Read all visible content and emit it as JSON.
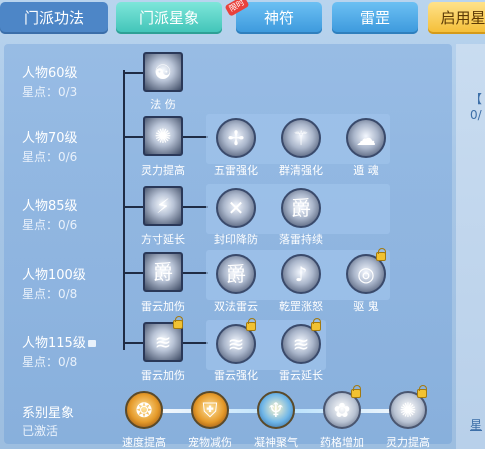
{
  "tabs": [
    {
      "label": "门派功法"
    },
    {
      "label": "门派星象"
    },
    {
      "label": "神符",
      "badge": "限时"
    },
    {
      "label": "雷罡"
    },
    {
      "label": "启用星"
    }
  ],
  "right_strip": {
    "bracket": "【",
    "value": "0/",
    "link": "星"
  },
  "tiers": [
    {
      "name": "人物60级",
      "stars": "星点：0/3"
    },
    {
      "name": "人物70级",
      "stars": "星点：0/6"
    },
    {
      "name": "人物85级",
      "stars": "星点：0/6"
    },
    {
      "name": "人物100级",
      "stars": "星点：0/8"
    },
    {
      "name": "人物115级",
      "stars": "星点：0/8"
    }
  ],
  "skills": {
    "main": [
      "法 伤",
      "灵力提高",
      "方寸延长",
      "雷云加伤",
      "雷云加伤"
    ],
    "row70": [
      "五雷强化",
      "群清强化",
      "遁 魂"
    ],
    "row85": [
      "封印降防",
      "落雷持续"
    ],
    "row100": [
      "双法雷云",
      "乾罡涨怒",
      "驱 鬼"
    ],
    "row115": [
      "雷云强化",
      "雷云延长"
    ]
  },
  "series": {
    "name": "系别星象",
    "status": "已激活",
    "items": [
      "速度提高",
      "宠物减伤",
      "凝神聚气",
      "药格增加",
      "灵力提高"
    ]
  },
  "colors": {
    "accent": "#3fc3b7",
    "gold": "#f4bd34",
    "tab": "#4d86c7"
  }
}
